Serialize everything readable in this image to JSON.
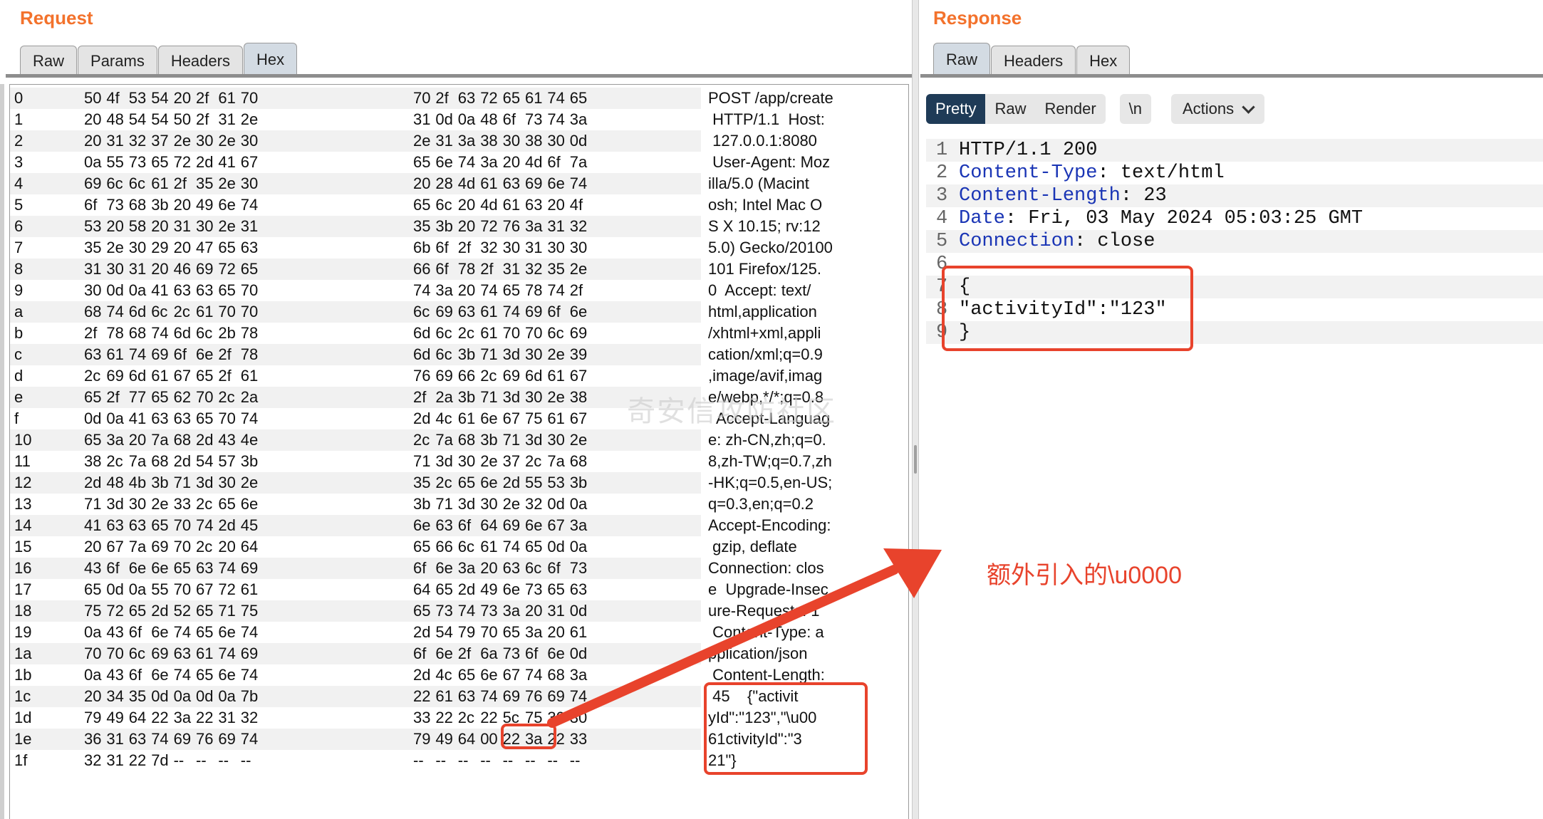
{
  "request": {
    "title": "Request",
    "tabs": [
      "Raw",
      "Params",
      "Headers",
      "Hex"
    ],
    "active_tab": "Hex",
    "hex_rows": [
      {
        "offset": "0",
        "bytes": [
          "50",
          "4f",
          "53",
          "54",
          "20",
          "2f",
          "61",
          "70",
          "70",
          "2f",
          "63",
          "72",
          "65",
          "61",
          "74",
          "65"
        ],
        "ascii": "POST /app/create"
      },
      {
        "offset": "1",
        "bytes": [
          "20",
          "48",
          "54",
          "54",
          "50",
          "2f",
          "31",
          "2e",
          "31",
          "0d",
          "0a",
          "48",
          "6f",
          "73",
          "74",
          "3a"
        ],
        "ascii": " HTTP/1.1  Host:"
      },
      {
        "offset": "2",
        "bytes": [
          "20",
          "31",
          "32",
          "37",
          "2e",
          "30",
          "2e",
          "30",
          "2e",
          "31",
          "3a",
          "38",
          "30",
          "38",
          "30",
          "0d"
        ],
        "ascii": " 127.0.0.1:8080"
      },
      {
        "offset": "3",
        "bytes": [
          "0a",
          "55",
          "73",
          "65",
          "72",
          "2d",
          "41",
          "67",
          "65",
          "6e",
          "74",
          "3a",
          "20",
          "4d",
          "6f",
          "7a"
        ],
        "ascii": " User-Agent: Moz"
      },
      {
        "offset": "4",
        "bytes": [
          "69",
          "6c",
          "6c",
          "61",
          "2f",
          "35",
          "2e",
          "30",
          "20",
          "28",
          "4d",
          "61",
          "63",
          "69",
          "6e",
          "74"
        ],
        "ascii": "illa/5.0 (Macint"
      },
      {
        "offset": "5",
        "bytes": [
          "6f",
          "73",
          "68",
          "3b",
          "20",
          "49",
          "6e",
          "74",
          "65",
          "6c",
          "20",
          "4d",
          "61",
          "63",
          "20",
          "4f"
        ],
        "ascii": "osh; Intel Mac O"
      },
      {
        "offset": "6",
        "bytes": [
          "53",
          "20",
          "58",
          "20",
          "31",
          "30",
          "2e",
          "31",
          "35",
          "3b",
          "20",
          "72",
          "76",
          "3a",
          "31",
          "32"
        ],
        "ascii": "S X 10.15; rv:12"
      },
      {
        "offset": "7",
        "bytes": [
          "35",
          "2e",
          "30",
          "29",
          "20",
          "47",
          "65",
          "63",
          "6b",
          "6f",
          "2f",
          "32",
          "30",
          "31",
          "30",
          "30"
        ],
        "ascii": "5.0) Gecko/20100"
      },
      {
        "offset": "8",
        "bytes": [
          "31",
          "30",
          "31",
          "20",
          "46",
          "69",
          "72",
          "65",
          "66",
          "6f",
          "78",
          "2f",
          "31",
          "32",
          "35",
          "2e"
        ],
        "ascii": "101 Firefox/125."
      },
      {
        "offset": "9",
        "bytes": [
          "30",
          "0d",
          "0a",
          "41",
          "63",
          "63",
          "65",
          "70",
          "74",
          "3a",
          "20",
          "74",
          "65",
          "78",
          "74",
          "2f"
        ],
        "ascii": "0  Accept: text/"
      },
      {
        "offset": "a",
        "bytes": [
          "68",
          "74",
          "6d",
          "6c",
          "2c",
          "61",
          "70",
          "70",
          "6c",
          "69",
          "63",
          "61",
          "74",
          "69",
          "6f",
          "6e"
        ],
        "ascii": "html,application"
      },
      {
        "offset": "b",
        "bytes": [
          "2f",
          "78",
          "68",
          "74",
          "6d",
          "6c",
          "2b",
          "78",
          "6d",
          "6c",
          "2c",
          "61",
          "70",
          "70",
          "6c",
          "69"
        ],
        "ascii": "/xhtml+xml,appli"
      },
      {
        "offset": "c",
        "bytes": [
          "63",
          "61",
          "74",
          "69",
          "6f",
          "6e",
          "2f",
          "78",
          "6d",
          "6c",
          "3b",
          "71",
          "3d",
          "30",
          "2e",
          "39"
        ],
        "ascii": "cation/xml;q=0.9"
      },
      {
        "offset": "d",
        "bytes": [
          "2c",
          "69",
          "6d",
          "61",
          "67",
          "65",
          "2f",
          "61",
          "76",
          "69",
          "66",
          "2c",
          "69",
          "6d",
          "61",
          "67"
        ],
        "ascii": ",image/avif,imag"
      },
      {
        "offset": "e",
        "bytes": [
          "65",
          "2f",
          "77",
          "65",
          "62",
          "70",
          "2c",
          "2a",
          "2f",
          "2a",
          "3b",
          "71",
          "3d",
          "30",
          "2e",
          "38"
        ],
        "ascii": "e/webp,*/*;q=0.8"
      },
      {
        "offset": "f",
        "bytes": [
          "0d",
          "0a",
          "41",
          "63",
          "63",
          "65",
          "70",
          "74",
          "2d",
          "4c",
          "61",
          "6e",
          "67",
          "75",
          "61",
          "67"
        ],
        "ascii": "  Accept-Languag"
      },
      {
        "offset": "10",
        "bytes": [
          "65",
          "3a",
          "20",
          "7a",
          "68",
          "2d",
          "43",
          "4e",
          "2c",
          "7a",
          "68",
          "3b",
          "71",
          "3d",
          "30",
          "2e"
        ],
        "ascii": "e: zh-CN,zh;q=0."
      },
      {
        "offset": "11",
        "bytes": [
          "38",
          "2c",
          "7a",
          "68",
          "2d",
          "54",
          "57",
          "3b",
          "71",
          "3d",
          "30",
          "2e",
          "37",
          "2c",
          "7a",
          "68"
        ],
        "ascii": "8,zh-TW;q=0.7,zh"
      },
      {
        "offset": "12",
        "bytes": [
          "2d",
          "48",
          "4b",
          "3b",
          "71",
          "3d",
          "30",
          "2e",
          "35",
          "2c",
          "65",
          "6e",
          "2d",
          "55",
          "53",
          "3b"
        ],
        "ascii": "-HK;q=0.5,en-US;"
      },
      {
        "offset": "13",
        "bytes": [
          "71",
          "3d",
          "30",
          "2e",
          "33",
          "2c",
          "65",
          "6e",
          "3b",
          "71",
          "3d",
          "30",
          "2e",
          "32",
          "0d",
          "0a"
        ],
        "ascii": "q=0.3,en;q=0.2"
      },
      {
        "offset": "14",
        "bytes": [
          "41",
          "63",
          "63",
          "65",
          "70",
          "74",
          "2d",
          "45",
          "6e",
          "63",
          "6f",
          "64",
          "69",
          "6e",
          "67",
          "3a"
        ],
        "ascii": "Accept-Encoding:"
      },
      {
        "offset": "15",
        "bytes": [
          "20",
          "67",
          "7a",
          "69",
          "70",
          "2c",
          "20",
          "64",
          "65",
          "66",
          "6c",
          "61",
          "74",
          "65",
          "0d",
          "0a"
        ],
        "ascii": " gzip, deflate"
      },
      {
        "offset": "16",
        "bytes": [
          "43",
          "6f",
          "6e",
          "6e",
          "65",
          "63",
          "74",
          "69",
          "6f",
          "6e",
          "3a",
          "20",
          "63",
          "6c",
          "6f",
          "73"
        ],
        "ascii": "Connection: clos"
      },
      {
        "offset": "17",
        "bytes": [
          "65",
          "0d",
          "0a",
          "55",
          "70",
          "67",
          "72",
          "61",
          "64",
          "65",
          "2d",
          "49",
          "6e",
          "73",
          "65",
          "63"
        ],
        "ascii": "e  Upgrade-Insec"
      },
      {
        "offset": "18",
        "bytes": [
          "75",
          "72",
          "65",
          "2d",
          "52",
          "65",
          "71",
          "75",
          "65",
          "73",
          "74",
          "73",
          "3a",
          "20",
          "31",
          "0d"
        ],
        "ascii": "ure-Requests: 1"
      },
      {
        "offset": "19",
        "bytes": [
          "0a",
          "43",
          "6f",
          "6e",
          "74",
          "65",
          "6e",
          "74",
          "2d",
          "54",
          "79",
          "70",
          "65",
          "3a",
          "20",
          "61"
        ],
        "ascii": " Content-Type: a"
      },
      {
        "offset": "1a",
        "bytes": [
          "70",
          "70",
          "6c",
          "69",
          "63",
          "61",
          "74",
          "69",
          "6f",
          "6e",
          "2f",
          "6a",
          "73",
          "6f",
          "6e",
          "0d"
        ],
        "ascii": "pplication/json"
      },
      {
        "offset": "1b",
        "bytes": [
          "0a",
          "43",
          "6f",
          "6e",
          "74",
          "65",
          "6e",
          "74",
          "2d",
          "4c",
          "65",
          "6e",
          "67",
          "74",
          "68",
          "3a"
        ],
        "ascii": " Content-Length:"
      },
      {
        "offset": "1c",
        "bytes": [
          "20",
          "34",
          "35",
          "0d",
          "0a",
          "0d",
          "0a",
          "7b",
          "22",
          "61",
          "63",
          "74",
          "69",
          "76",
          "69",
          "74"
        ],
        "ascii": " 45    {\"activit"
      },
      {
        "offset": "1d",
        "bytes": [
          "79",
          "49",
          "64",
          "22",
          "3a",
          "22",
          "31",
          "32",
          "33",
          "22",
          "2c",
          "22",
          "5c",
          "75",
          "30",
          "30"
        ],
        "ascii": "yId\":\"123\",\"\\u00"
      },
      {
        "offset": "1e",
        "bytes": [
          "36",
          "31",
          "63",
          "74",
          "69",
          "76",
          "69",
          "74",
          "79",
          "49",
          "64",
          "00",
          "22",
          "3a",
          "22",
          "33"
        ],
        "ascii": "61ctivityId\":\"3"
      },
      {
        "offset": "1f",
        "bytes": [
          "32",
          "31",
          "22",
          "7d",
          "--",
          "--",
          "--",
          "--",
          "--",
          "--",
          "--",
          "--",
          "--",
          "--",
          "--",
          "--"
        ],
        "ascii": "21\"}"
      }
    ]
  },
  "response": {
    "title": "Response",
    "tabs": [
      "Raw",
      "Headers",
      "Hex"
    ],
    "active_tab": "Raw",
    "toolbar": {
      "pretty": "Pretty",
      "raw": "Raw",
      "render": "Render",
      "newline": "\\n",
      "actions": "Actions"
    },
    "lines": [
      {
        "num": "1",
        "key": "",
        "value": "HTTP/1.1 200"
      },
      {
        "num": "2",
        "key": "Content-Type",
        "value": ": text/html"
      },
      {
        "num": "3",
        "key": "Content-Length",
        "value": ": 23"
      },
      {
        "num": "4",
        "key": "Date",
        "value": ": Fri, 03 May 2024 05:03:25 GMT"
      },
      {
        "num": "5",
        "key": "Connection",
        "value": ": close"
      },
      {
        "num": "6",
        "key": "",
        "value": ""
      },
      {
        "num": "7",
        "key": "",
        "value": "{"
      },
      {
        "num": "8",
        "key": "",
        "value": "\"activityId\":\"123\""
      },
      {
        "num": "9",
        "key": "",
        "value": "}"
      }
    ]
  },
  "annotation": {
    "text": "额外引入的\\u0000",
    "color": "#e8432c"
  },
  "watermark": "奇安信攻防社区",
  "colors": {
    "title_orange": "#f3722c",
    "accent_navy": "#1f3b57",
    "header_key_blue": "#1a35b5",
    "highlight_red": "#e8432c"
  }
}
